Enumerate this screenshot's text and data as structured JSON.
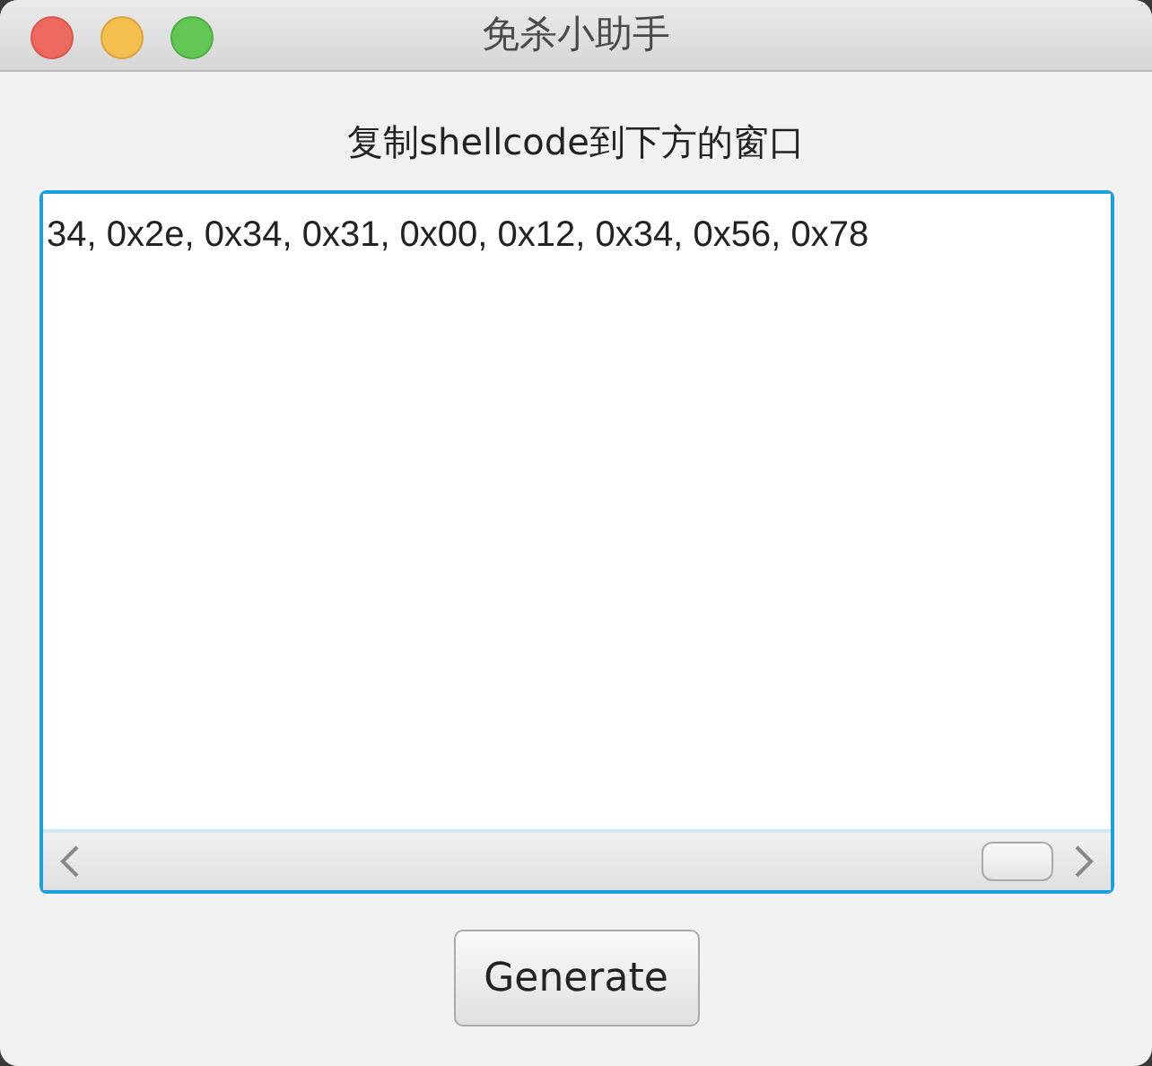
{
  "window": {
    "title": "免杀小助手"
  },
  "instruction": "复制shellcode到下方的窗口",
  "text_area": {
    "value": "34, 0x2e, 0x34, 0x31, 0x00, 0x12, 0x34, 0x56, 0x78",
    "focused": true
  },
  "buttons": [
    "Generate"
  ]
}
